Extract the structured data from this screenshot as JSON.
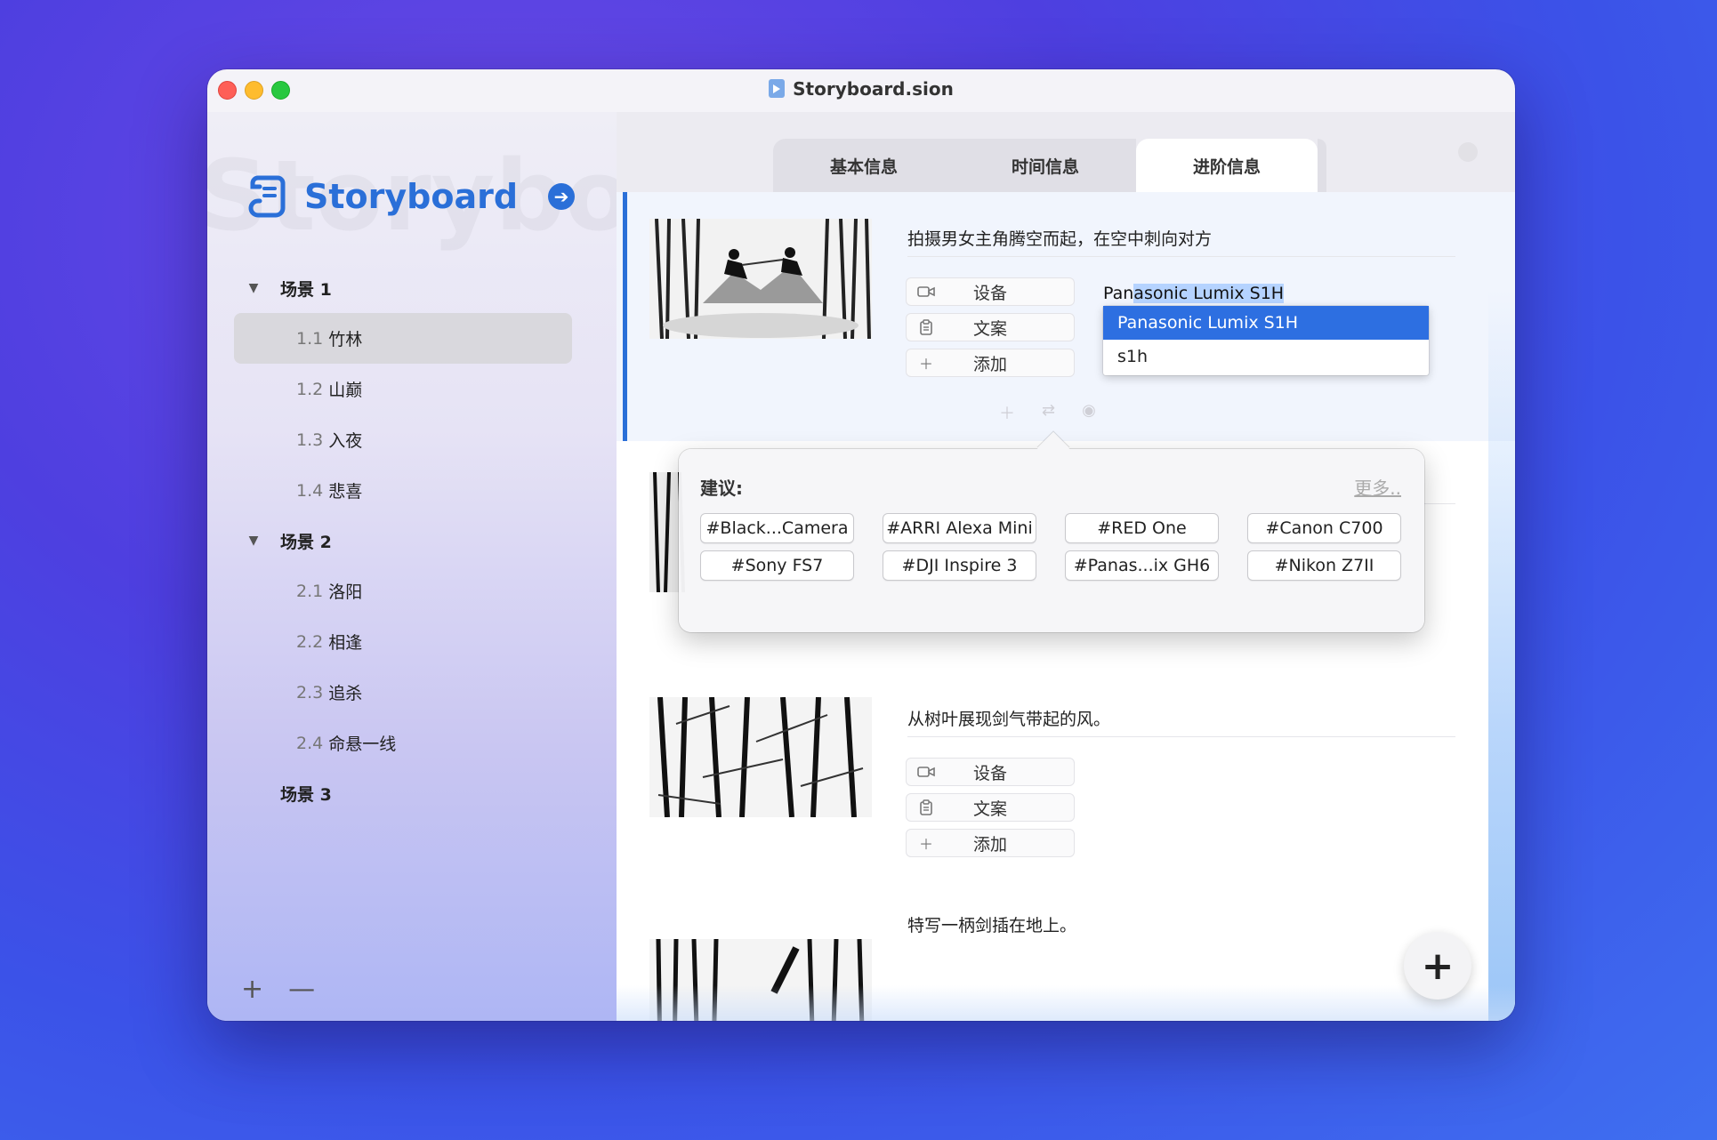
{
  "window": {
    "title": "Storyboard.sion"
  },
  "sidebar": {
    "app_name": "Storyboard",
    "watermark": "Storyboard",
    "scenes": [
      {
        "label": "场景 1",
        "expanded": true,
        "shots": [
          {
            "num": "1.1",
            "name": "竹林",
            "selected": true
          },
          {
            "num": "1.2",
            "name": "山巅"
          },
          {
            "num": "1.3",
            "name": "入夜"
          },
          {
            "num": "1.4",
            "name": "悲喜"
          }
        ]
      },
      {
        "label": "场景 2",
        "expanded": true,
        "shots": [
          {
            "num": "2.1",
            "name": "洛阳"
          },
          {
            "num": "2.2",
            "name": "相逢"
          },
          {
            "num": "2.3",
            "name": "追杀"
          },
          {
            "num": "2.4",
            "name": "命悬一线"
          }
        ]
      },
      {
        "label": "场景 3",
        "expanded": false,
        "shots": []
      }
    ],
    "footer": {
      "add": "+",
      "remove": "—"
    }
  },
  "tabs": [
    {
      "label": "基本信息"
    },
    {
      "label": "时间信息"
    },
    {
      "label": "进阶信息",
      "active": true
    }
  ],
  "shots": [
    {
      "description": "拍摄男女主角腾空而起，在空中刺向对方"
    },
    {
      "description": "从树叶展现剑气带起的风。"
    },
    {
      "description": "特写一柄剑插在地上。"
    }
  ],
  "properties": {
    "device": "设备",
    "copy": "文案",
    "add": "添加"
  },
  "editor": {
    "value": "Panasonic Lumix S1H",
    "value_plain": "Pan",
    "value_highlight": "asonic Lumix S1H",
    "options": [
      "Panasonic Lumix S1H",
      "s1h"
    ]
  },
  "suggestions": {
    "title": "建议:",
    "more": "更多..",
    "items": [
      "#Black...Camera",
      "#ARRI Alexa Mini",
      "#RED One",
      "#Canon C700",
      "#Sony FS7",
      "#DJI Inspire 3",
      "#Panas...ix GH6",
      "#Nikon Z7II"
    ]
  },
  "fab": {
    "label": "+"
  },
  "colors": {
    "accent": "#2a6fd8",
    "selection": "#2d6fe1"
  }
}
